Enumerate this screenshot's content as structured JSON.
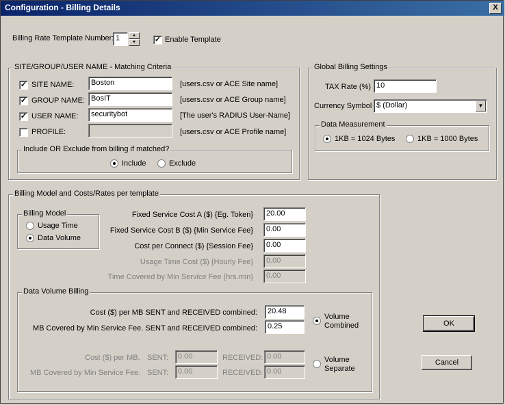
{
  "window": {
    "title": "Configuration - Billing Details",
    "close_glyph": "X"
  },
  "template": {
    "label": "Billing Rate Template Number:",
    "number": "1",
    "enable_label": "Enable Template",
    "enabled": true
  },
  "matching": {
    "legend": "SITE/GROUP/USER NAME - Matching Criteria",
    "rows": [
      {
        "label": "SITE NAME:",
        "value": "Boston",
        "hint": "[users.csv or ACE Site name]",
        "checked": true
      },
      {
        "label": "GROUP NAME:",
        "value": "BosIT",
        "hint": "[users.csv or ACE Group name]",
        "checked": true
      },
      {
        "label": "USER NAME:",
        "value": "securitybot",
        "hint": "[The user's RADIUS User-Name]",
        "checked": true
      },
      {
        "label": "PROFILE:",
        "value": "",
        "hint": "[users.csv or ACE Profile name]",
        "checked": false
      }
    ],
    "include_legend": "Include OR Exclude from billing if matched?",
    "include_label": "Include",
    "exclude_label": "Exclude",
    "selected": "Include"
  },
  "global": {
    "legend": "Global Billing Settings",
    "tax_label": "TAX Rate (%)",
    "tax_value": "10",
    "currency_label": "Currency Symbol",
    "currency_value": "$ (Dollar)",
    "measure_legend": "Data Measurement",
    "opt1": "1KB = 1024 Bytes",
    "opt2": "1KB = 1000 Bytes",
    "selected": "1KB = 1024 Bytes"
  },
  "model": {
    "legend": "Billing Model and Costs/Rates per template",
    "model_legend": "Billing Model",
    "usage_label": "Usage Time",
    "volume_label": "Data Volume",
    "selected": "Data Volume",
    "fields": [
      {
        "label": "Fixed Service Cost A ($) {Eg. Token}",
        "value": "20.00",
        "enabled": true
      },
      {
        "label": "Fixed Service Cost B ($) {Min Service Fee}",
        "value": "0.00",
        "enabled": true
      },
      {
        "label": "Cost per Connect ($) {Session Fee}",
        "value": "0.00",
        "enabled": true
      },
      {
        "label": "Usage Time Cost ($) {Hourly Fee}",
        "value": "0.00",
        "enabled": false
      },
      {
        "label": "Time Covered by Min Service Fee {hrs.min}",
        "value": "0.00",
        "enabled": false
      }
    ]
  },
  "volume": {
    "legend": "Data Volume Billing",
    "cost_label": "Cost ($) per MB SENT and RECEIVED combined:",
    "cost_value": "20.48",
    "covered_label": "MB Covered by Min Service Fee. SENT and RECEIVED combined:",
    "covered_value": "0.25",
    "combined_label_1": "Volume",
    "combined_label_2": "Combined",
    "sep_cost_label": "Cost ($) per MB.",
    "sep_covered_label": "MB Covered by Min Service Fee.",
    "sent_label": "SENT:",
    "received_label": "RECEIVED:",
    "sep_cost_sent": "0.00",
    "sep_cost_recv": "0.00",
    "sep_cov_sent": "0.00",
    "sep_cov_recv": "0.00",
    "separate_label_1": "Volume",
    "separate_label_2": "Separate",
    "selected": "Combined"
  },
  "buttons": {
    "ok": "OK",
    "cancel": "Cancel"
  }
}
